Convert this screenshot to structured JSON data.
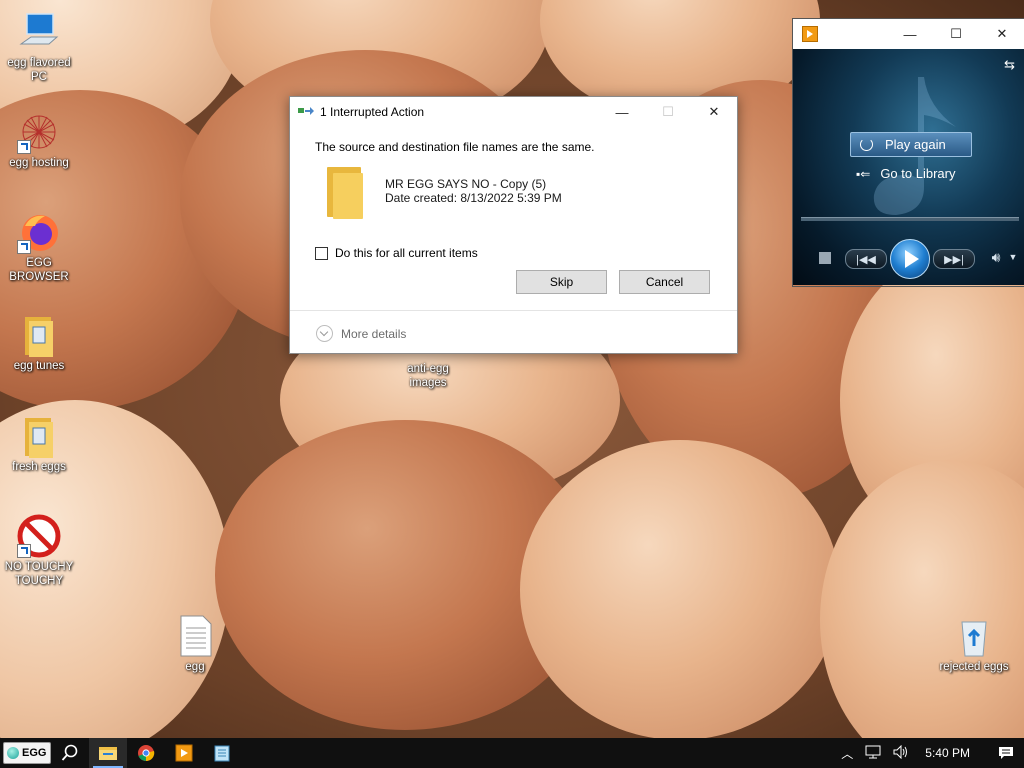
{
  "desktop": {
    "icons": [
      {
        "label": "egg flavored PC",
        "icon": "computer-icon"
      },
      {
        "label": "egg hosting",
        "icon": "starburst-icon"
      },
      {
        "label": "EGG BROWSER",
        "icon": "firefox-icon"
      },
      {
        "label": "egg tunes",
        "icon": "folder-icon"
      },
      {
        "label": "fresh eggs",
        "icon": "folder-icon"
      },
      {
        "label": "NO TOUCHY TOUCHY",
        "icon": "prohibited-icon"
      },
      {
        "label": "anti-egg images",
        "icon": "folder-icon"
      },
      {
        "label": "egg",
        "icon": "text-file-icon"
      },
      {
        "label": "rejected eggs",
        "icon": "recycle-bin-icon"
      }
    ]
  },
  "dialog": {
    "title": "1 Interrupted Action",
    "message": "The source and destination file names are the same.",
    "file_name": "MR EGG SAYS NO - Copy (5)",
    "file_date": "Date created: 8/13/2022 5:39 PM",
    "checkbox_label": "Do this for all current items",
    "checkbox_checked": false,
    "skip_label": "Skip",
    "cancel_label": "Cancel",
    "more_details": "More details",
    "minimize": "—",
    "maximize": "☐",
    "close": "✕"
  },
  "player": {
    "play_again": "Play again",
    "go_to_library": "Go to Library",
    "minimize": "—",
    "maximize": "☐",
    "close": "✕",
    "accent": "#2a5a86"
  },
  "taskbar": {
    "start_label": "EGG",
    "time": "5:40 PM",
    "pinned": [
      "search-icon",
      "file-explorer-icon",
      "chrome-icon",
      "media-player-icon",
      "notepad-icon"
    ]
  }
}
